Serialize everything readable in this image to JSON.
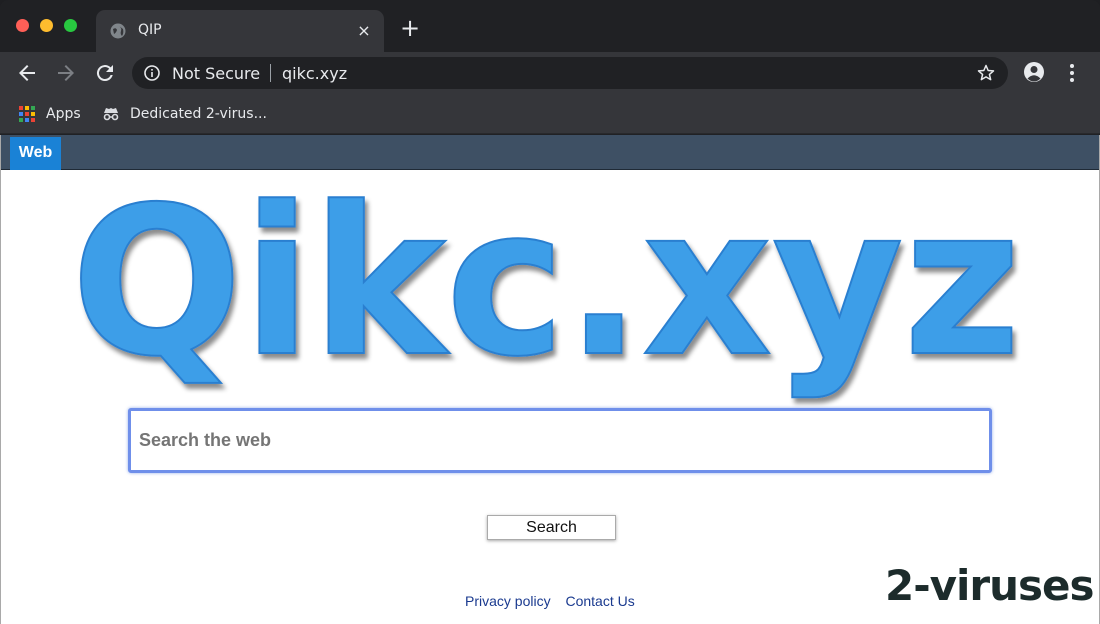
{
  "browser": {
    "tab_title": "QIP",
    "tab_close": "×",
    "new_tab": "+",
    "security_label": "Not Secure",
    "url": "qikc.xyz",
    "bookmarks": [
      {
        "label": "Apps",
        "icon": "apps-grid-icon"
      },
      {
        "label": "Dedicated 2-virus...",
        "icon": "spy-icon"
      }
    ],
    "traffic_colors": {
      "close": "#ff5f57",
      "minimize": "#febc2e",
      "maximize": "#28c840"
    }
  },
  "site": {
    "nav_tab": "Web",
    "logo_text": "Qikc.xyz",
    "logo_color": "#3c9ee8",
    "search_placeholder": "Search the web",
    "search_button": "Search",
    "footer_links": [
      "Privacy policy",
      "Contact Us"
    ],
    "watermark": "2-viruses"
  }
}
